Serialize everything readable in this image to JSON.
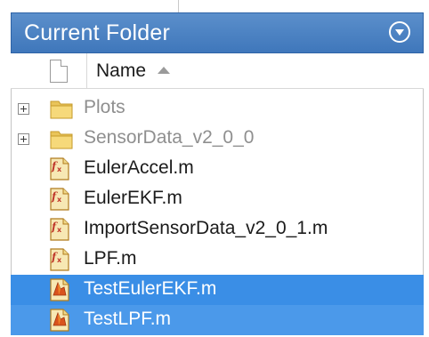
{
  "panel": {
    "title": "Current Folder"
  },
  "header": {
    "name_label": "Name"
  },
  "items": [
    {
      "label": "Plots",
      "kind": "folder",
      "expandable": true,
      "selected": false
    },
    {
      "label": "SensorData_v2_0_0",
      "kind": "folder",
      "expandable": true,
      "selected": false
    },
    {
      "label": "EulerAccel.m",
      "kind": "function",
      "expandable": false,
      "selected": false
    },
    {
      "label": "EulerEKF.m",
      "kind": "function",
      "expandable": false,
      "selected": false
    },
    {
      "label": "ImportSensorData_v2_0_1.m",
      "kind": "function",
      "expandable": false,
      "selected": false
    },
    {
      "label": "LPF.m",
      "kind": "function",
      "expandable": false,
      "selected": false
    },
    {
      "label": "TestEulerEKF.m",
      "kind": "script",
      "expandable": false,
      "selected": true
    },
    {
      "label": "TestLPF.m",
      "kind": "script",
      "expandable": false,
      "selected": true
    }
  ],
  "icons": {
    "panel_menu": "actions-menu-icon",
    "sort": "sort-ascending-icon",
    "folder": "folder-icon",
    "function": "function-file-icon",
    "script": "script-file-icon",
    "expander": "expand-plus-icon"
  },
  "colors": {
    "title_bar": "#4a82c3",
    "selection": "#3a8ee6",
    "folder_text": "#8f8f8f",
    "file_text": "#1b1b1b"
  }
}
